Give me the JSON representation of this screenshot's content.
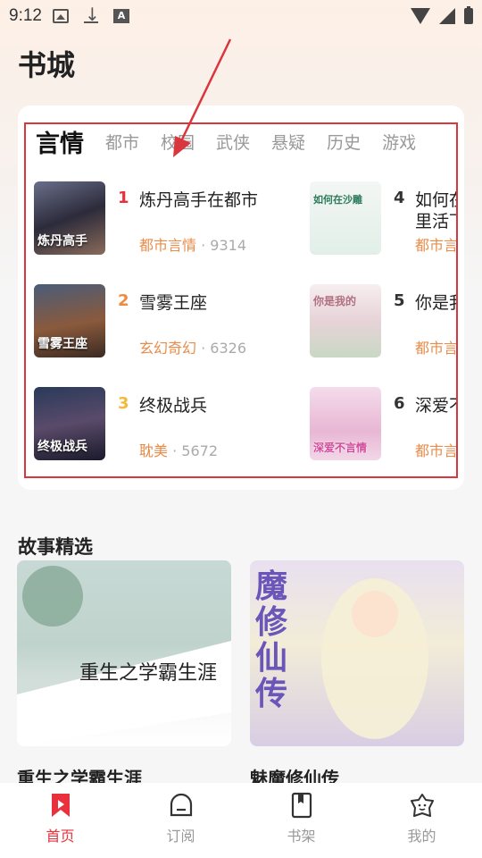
{
  "status_bar": {
    "time": "9:12",
    "icons": [
      "image-icon",
      "download-icon",
      "a-icon"
    ],
    "right_icons": [
      "wifi-icon",
      "signal-icon",
      "battery-icon"
    ]
  },
  "page_title": "书城",
  "tabs": [
    {
      "label": "言情",
      "active": true
    },
    {
      "label": "都市",
      "active": false
    },
    {
      "label": "校园",
      "active": false
    },
    {
      "label": "武侠",
      "active": false
    },
    {
      "label": "悬疑",
      "active": false
    },
    {
      "label": "历史",
      "active": false
    },
    {
      "label": "游戏",
      "active": false
    }
  ],
  "books": [
    {
      "rank": "1",
      "title": "炼丹高手在都市",
      "category": "都市言情",
      "dot": "·",
      "count": "9314",
      "cover_text": "炼丹高手",
      "rank_color": "#e8313d"
    },
    {
      "rank": "2",
      "title": "雪雾王座",
      "category": "玄幻奇幻",
      "dot": "·",
      "count": "6326",
      "cover_text": "雪雾王座",
      "rank_color": "#f08a3c"
    },
    {
      "rank": "3",
      "title": "终极战兵",
      "category": "耽美",
      "dot": "·",
      "count": "5672",
      "cover_text": "终极战兵",
      "rank_color": "#f5b93a"
    },
    {
      "rank": "4",
      "title_line1": "如何在",
      "title_line2": "里活下",
      "category": "都市言",
      "cover_text": "如何在沙雕",
      "rank_color": "#333"
    },
    {
      "rank": "5",
      "title": "你是我",
      "category": "都市言",
      "cover_text": "你是我的",
      "rank_color": "#333"
    },
    {
      "rank": "6",
      "title": "深爱不",
      "category": "都市言",
      "cover_text": "深爱不言情",
      "rank_color": "#333"
    }
  ],
  "section_title": "故事精选",
  "stories": [
    {
      "title": "重生之学霸生涯",
      "cover_text": "重生之学霸生涯"
    },
    {
      "title": "魅魔修仙传",
      "cover_text": "魔修仙传"
    }
  ],
  "nav": [
    {
      "label": "首页",
      "icon": "bookmark-home-icon",
      "active": true
    },
    {
      "label": "订阅",
      "icon": "subscribe-icon",
      "active": false
    },
    {
      "label": "书架",
      "icon": "bookshelf-icon",
      "active": false
    },
    {
      "label": "我的",
      "icon": "profile-icon",
      "active": false
    }
  ],
  "colors": {
    "accent": "#e8313d",
    "category": "#e88c4a",
    "highlight": "#d9363e"
  }
}
